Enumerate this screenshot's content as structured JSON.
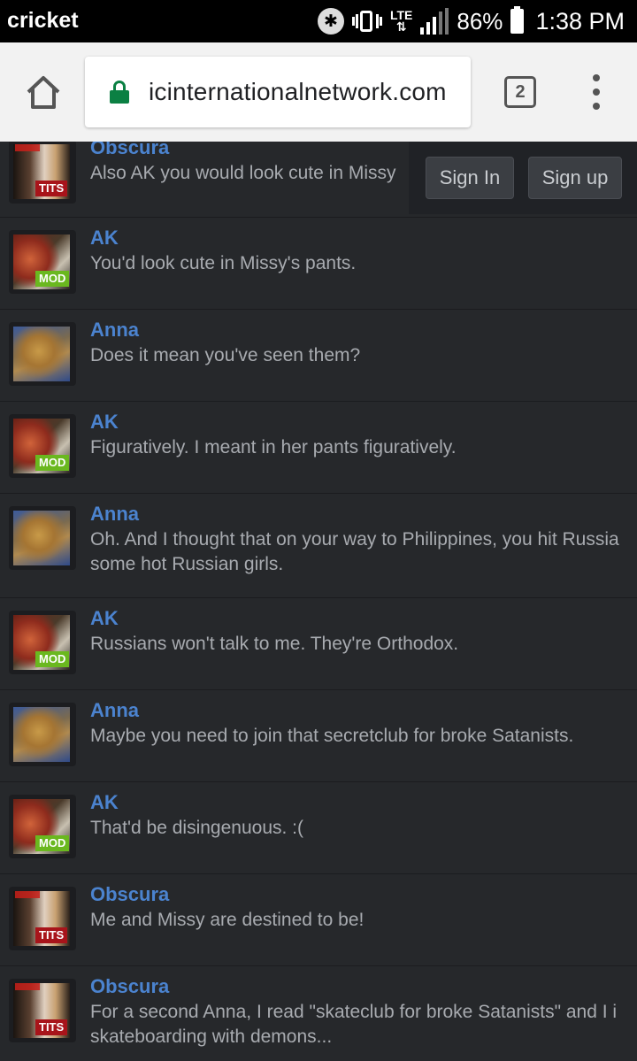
{
  "status_bar": {
    "carrier": "cricket",
    "network": "LTE",
    "battery": "86%",
    "time": "1:38 PM"
  },
  "browser": {
    "url": "icinternationalnetwork.com",
    "tab_count": "2"
  },
  "auth": {
    "sign_in": "Sign In",
    "sign_up": "Sign up"
  },
  "badges": {
    "mod": "MOD",
    "tits": "TITS"
  },
  "messages": [
    {
      "user": "Obscura",
      "badge": "TITS",
      "lines": [
        "Also AK you would look cute in Missy"
      ]
    },
    {
      "user": "AK",
      "badge": "MOD",
      "lines": [
        "You'd look cute in Missy's pants."
      ]
    },
    {
      "user": "Anna",
      "badge": "",
      "lines": [
        "Does it mean you've seen them?"
      ]
    },
    {
      "user": "AK",
      "badge": "MOD",
      "lines": [
        "Figuratively. I meant in her pants figuratively."
      ]
    },
    {
      "user": "Anna",
      "badge": "",
      "lines": [
        "Oh. And I thought that on your way to Philippines, you hit Russia",
        "some hot Russian girls."
      ]
    },
    {
      "user": "AK",
      "badge": "MOD",
      "lines": [
        "Russians won't talk to me. They're Orthodox."
      ]
    },
    {
      "user": "Anna",
      "badge": "",
      "lines": [
        "Maybe you need to join that secretclub for broke Satanists."
      ]
    },
    {
      "user": "AK",
      "badge": "MOD",
      "lines": [
        "That'd be disingenuous. :("
      ]
    },
    {
      "user": "Obscura",
      "badge": "TITS",
      "lines": [
        "Me and Missy are destined to be!"
      ]
    },
    {
      "user": "Obscura",
      "badge": "TITS",
      "lines": [
        "For a second Anna, I read \"skateclub for broke Satanists\" and I i",
        "skateboarding with demons..."
      ]
    }
  ]
}
